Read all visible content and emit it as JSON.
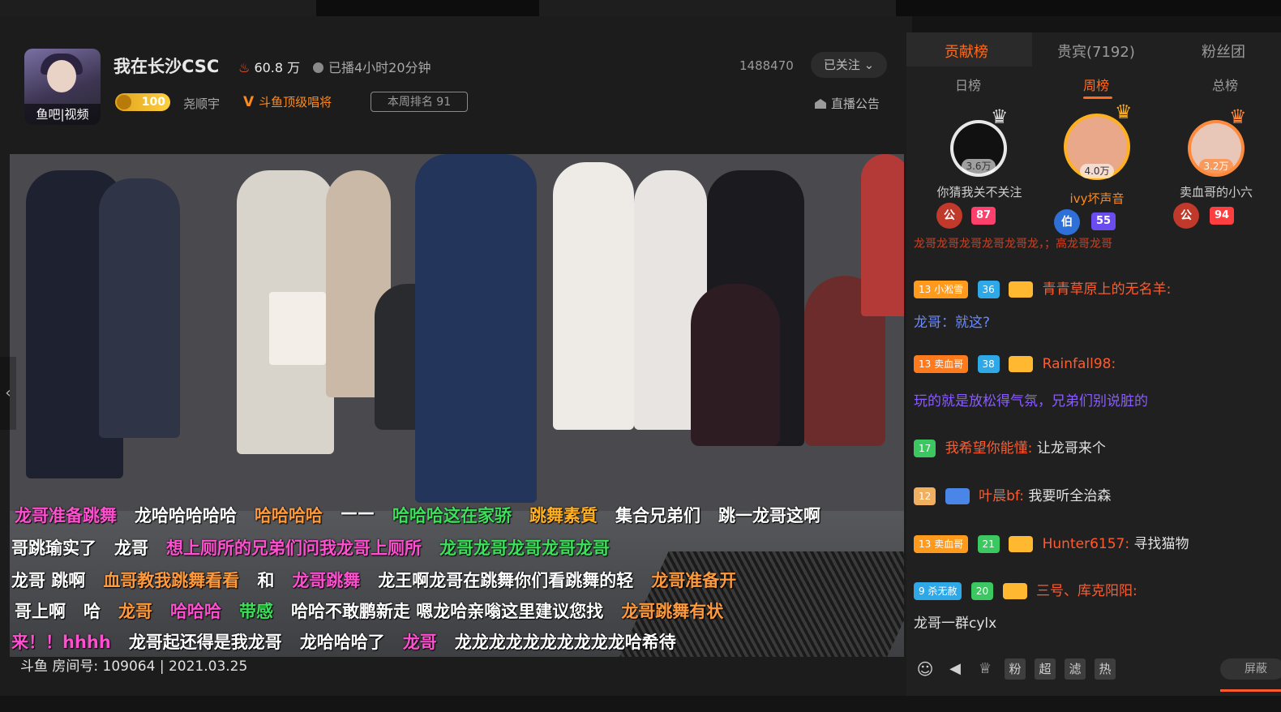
{
  "header": {
    "avatar_caption": "鱼吧|视频",
    "streamer_name": "我在长沙CSC",
    "hot_value": "60.8 万",
    "duration": "已播4小时20分钟",
    "room_number": "1488470",
    "follow_label": "已关注",
    "level": "100",
    "owner_label": "尧顺宇",
    "v_badge": "斗鱼顶级唱将",
    "weekly_rank": "本周排名 91",
    "announcement": "直播公告"
  },
  "video": {
    "watermark": "斗鱼 房间号: 109064 | 2021.03.25",
    "danmaku": [
      {
        "text": "龙哥准备跳舞",
        "color": "#ff4fd0"
      },
      {
        "text": "龙哈哈哈哈哈",
        "color": "#ffffff"
      },
      {
        "text": "哈哈哈哈",
        "color": "#ff9a3c"
      },
      {
        "text": "——",
        "color": "#ffffff"
      },
      {
        "text": "哈哈哈这在家骄",
        "color": "#3ce05a"
      },
      {
        "text": "跳舞素質",
        "color": "#ffb020"
      },
      {
        "text": "集合兄弟们",
        "color": "#ffffff"
      },
      {
        "text": "跳一龙哥这啊",
        "color": "#ffffff"
      },
      {
        "text": "哥跳瑜实了",
        "color": "#ffffff"
      },
      {
        "text": "龙哥",
        "color": "#ffffff"
      },
      {
        "text": "想上厕所的兄弟们问我龙哥上厕所",
        "color": "#ff4fd0"
      },
      {
        "text": "龙哥龙哥龙哥龙哥龙哥",
        "color": "#3ce05a"
      },
      {
        "text": "龙哥 跳啊",
        "color": "#ffffff"
      },
      {
        "text": "血哥教我跳舞看看",
        "color": "#ff9a3c"
      },
      {
        "text": "和",
        "color": "#ffffff"
      },
      {
        "text": "龙哥跳舞",
        "color": "#ff4fd0"
      },
      {
        "text": "龙王啊龙哥在跳舞你们看跳舞的轻",
        "color": "#ffffff"
      },
      {
        "text": "龙哥准备开",
        "color": "#ff9a3c"
      },
      {
        "text": "哥上啊",
        "color": "#ffffff"
      },
      {
        "text": "哈",
        "color": "#ffffff"
      },
      {
        "text": "龙哥",
        "color": "#ff9a3c"
      },
      {
        "text": "哈哈哈",
        "color": "#ff4fd0"
      },
      {
        "text": "带感",
        "color": "#3ce05a"
      },
      {
        "text": "哈哈不敢鹏新走 嗯龙哈亲嗡这里建议您找",
        "color": "#ffffff"
      },
      {
        "text": "龙哥跳舞有状",
        "color": "#ff9a3c"
      },
      {
        "text": "来！！hhhh",
        "color": "#ff4fd0"
      },
      {
        "text": "龙哥起还得是我龙哥",
        "color": "#ffffff"
      },
      {
        "text": "龙哈哈哈了",
        "color": "#ffffff"
      },
      {
        "text": "龙哥",
        "color": "#ff4fd0"
      },
      {
        "text": "龙龙龙龙龙龙龙龙龙龙哈希待",
        "color": "#ffffff"
      }
    ]
  },
  "sidebar": {
    "tabs": [
      "贡献榜",
      "贵宾(7192)",
      "粉丝团"
    ],
    "subtabs": [
      "日榜",
      "周榜",
      "总榜"
    ],
    "top3": [
      {
        "name": "你猜我关不关注",
        "score": "3.6万",
        "name_color": "#a8a8a8",
        "noble": "公",
        "fan_badge": "87"
      },
      {
        "name": "ivy坏声音",
        "score": "4.0万",
        "name_color": "#ff8a1c",
        "noble": "伯",
        "fan_badge": "55"
      },
      {
        "name": "卖血哥的小六",
        "score": "3.2万",
        "name_color": "#a8a8a8",
        "noble": "公",
        "fan_badge": "94"
      }
    ],
    "chat_cut": "龙哥龙哥龙哥龙哥龙哥龙，；高龙哥龙哥",
    "chats": [
      {
        "badge": "13",
        "badge_text": "小淞雪",
        "fan": "36",
        "name": "青青草原上的无名羊:",
        "text": "龙哥：就这?",
        "text_color": "#6a88ff"
      },
      {
        "badge": "13",
        "badge_text": "卖血哥",
        "fan": "38",
        "name": "Rainfall98:",
        "text": "玩的就是放松得气氛，兄弟们别说脏的",
        "text_color": "#8a5cff"
      },
      {
        "badge": "",
        "badge_text": "",
        "fan": "17",
        "name": "我希望你能懂:",
        "text": "让龙哥来个",
        "text_color": "#e0e0e0"
      },
      {
        "badge": "12",
        "badge_text": "",
        "fan": "",
        "name": "叶晨bf:",
        "text": "我要听全治森",
        "text_color": "#e0e0e0"
      },
      {
        "badge": "13",
        "badge_text": "卖血哥",
        "fan": "21",
        "name": "Hunter6157:",
        "text": "寻找猫物",
        "text_color": "#e0e0e0"
      },
      {
        "badge": "9",
        "badge_text": "杀无赦",
        "fan": "20",
        "name": "三号、库克阳阳:",
        "text": "龙哥一群cylx",
        "text_color": "#e0e0e0"
      }
    ],
    "tools": [
      "粉",
      "超",
      "滤",
      "热"
    ],
    "block_label": "屏蔽"
  }
}
